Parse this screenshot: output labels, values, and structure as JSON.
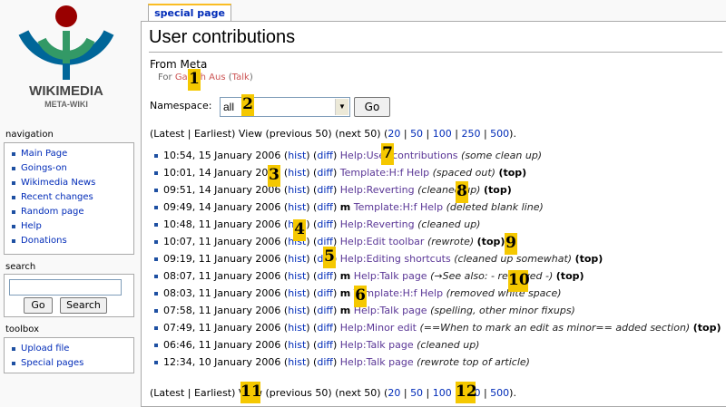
{
  "sidebar": {
    "logo_text": "WIKIMEDIA",
    "logo_sub": "META-WIKI",
    "navigation_title": "navigation",
    "navigation_items": [
      "Main Page",
      "Goings-on",
      "Wikimedia News",
      "Recent changes",
      "Random page",
      "Help",
      "Donations"
    ],
    "search_title": "search",
    "go_label": "Go",
    "search_label": "Search",
    "toolbox_title": "toolbox",
    "toolbox_items": [
      "Upload file",
      "Special pages"
    ]
  },
  "tab": {
    "label": "special page"
  },
  "main": {
    "title": "User contributions",
    "from": "From Meta",
    "for_prefix": "For",
    "user_name": "Gareth Aus",
    "talk_label": "Talk",
    "namespace_label": "Namespace:",
    "namespace_value": "all",
    "go_label": "Go",
    "nav_top": {
      "prefix": "(Latest | Earliest) View (previous 50) (next 50) (",
      "limits": [
        "20",
        "50",
        "100",
        "250",
        "500"
      ],
      "suffix": ")."
    },
    "nav_bottom": {
      "prefix": "(Latest | Earliest) View (previous 50) (next 50) (",
      "limits": [
        "20",
        "50",
        "100",
        "250",
        "500"
      ],
      "suffix": ")."
    },
    "hist_label": "hist",
    "diff_label": "diff",
    "top_label": "(top)",
    "minor_label": "m",
    "contributions": [
      {
        "time": "10:54, 15 January 2006",
        "minor": false,
        "page": "Help:User contributions",
        "comment": "(some clean up)",
        "top": false
      },
      {
        "time": "10:01, 14 January 2006",
        "minor": false,
        "page": "Template:H:f Help",
        "comment": "(spaced out)",
        "top": true
      },
      {
        "time": "09:51, 14 January 2006",
        "minor": false,
        "page": "Help:Reverting",
        "comment": "(cleaned up)",
        "top": true
      },
      {
        "time": "09:49, 14 January 2006",
        "minor": true,
        "page": "Template:H:f Help",
        "comment": "(deleted blank line)",
        "top": false
      },
      {
        "time": "10:48, 11 January 2006",
        "minor": false,
        "page": "Help:Reverting",
        "comment": "(cleaned up)",
        "top": false
      },
      {
        "time": "10:07, 11 January 2006",
        "minor": false,
        "page": "Help:Edit toolbar",
        "comment": "(rewrote)",
        "top": true
      },
      {
        "time": "09:19, 11 January 2006",
        "minor": false,
        "page": "Help:Editing shortcuts",
        "comment": "(cleaned up somewhat)",
        "top": true
      },
      {
        "time": "08:07, 11 January 2006",
        "minor": true,
        "page": "Help:Talk page",
        "comment": "(→See also: - removed -)",
        "top": true
      },
      {
        "time": "08:03, 11 January 2006",
        "minor": true,
        "page": "Template:H:f Help",
        "comment": "(removed white space)",
        "top": false
      },
      {
        "time": "07:58, 11 January 2006",
        "minor": true,
        "page": "Help:Talk page",
        "comment": "(spelling, other minor fixups)",
        "top": false
      },
      {
        "time": "07:49, 11 January 2006",
        "minor": false,
        "page": "Help:Minor edit",
        "comment": "(==When to mark an edit as minor== added section)",
        "top": true
      },
      {
        "time": "06:46, 11 January 2006",
        "minor": false,
        "page": "Help:Talk page",
        "comment": "(cleaned up)",
        "top": false
      },
      {
        "time": "12:34, 10 January 2006",
        "minor": false,
        "page": "Help:Talk page",
        "comment": "(rewrote top of article)",
        "top": false
      }
    ]
  },
  "markers": [
    "1",
    "2",
    "3",
    "4",
    "5",
    "6",
    "7",
    "8",
    "9",
    "10",
    "11",
    "12"
  ],
  "colors": {
    "link": "#002bb8",
    "visited": "#5a3696",
    "marker": "#f5c800",
    "border": "#aaaaaa"
  }
}
